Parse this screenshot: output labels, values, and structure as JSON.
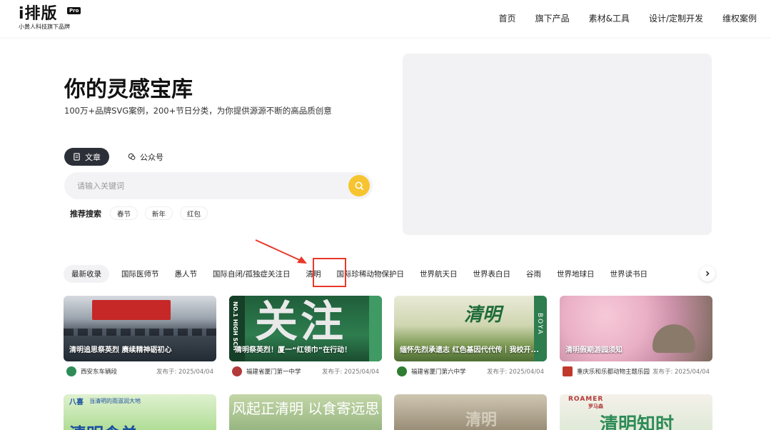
{
  "header": {
    "logo_text": "i排版",
    "logo_badge": "Pro",
    "logo_sub": "小黄人科技旗下品牌",
    "nav": [
      "首页",
      "旗下产品",
      "素材&工具",
      "设计/定制开发",
      "维权案例"
    ]
  },
  "hero": {
    "title": "你的灵感宝库",
    "subtitle": "100万+品牌SVG案例，200+节日分类，为你提供源源不断的高品质创意",
    "tabs": [
      {
        "label": "文章",
        "icon": "document-icon"
      },
      {
        "label": "公众号",
        "icon": "wechat-icon"
      }
    ],
    "search_placeholder": "请输入关键词",
    "hot_label": "推荐搜索",
    "hot_tags": [
      "春节",
      "新年",
      "红包"
    ]
  },
  "categories": [
    "最新收录",
    "国际医师节",
    "愚人节",
    "国际自闭/孤独症关注日",
    "清明",
    "国际珍稀动物保护日",
    "世界航天日",
    "世界表白日",
    "谷雨",
    "世界地球日",
    "世界读书日"
  ],
  "cards": [
    {
      "title": "清明追思祭英烈 赓续精神砺初心",
      "author": "西安东车辆段",
      "date": "发布于: 2025/04/04",
      "avatar_color": "#2e8b57"
    },
    {
      "title": "清明祭英烈！厦一“红领巾”在行动！",
      "author": "福建省厦门第一中学",
      "date": "发布于: 2025/04/04",
      "avatar_color": "#b33a3a"
    },
    {
      "title": "缅怀先烈承遗志 红色基因代代传｜我校开...",
      "author": "福建省厦门第六中学",
      "date": "发布于: 2025/04/04",
      "avatar_color": "#2f7d32"
    },
    {
      "title": "清明假期游园须知",
      "author": "重庆乐和乐都动物主题乐园",
      "date": "发布于: 2025/04/04",
      "avatar_color": "#c0392b"
    }
  ],
  "card_overlays": {
    "card2_big": "关注",
    "card2_side": "NO.1 HIGH SCH",
    "card3_big": "清明",
    "card3_side": "BOYA"
  },
  "row2": {
    "c1_brand": "八喜",
    "c1_tag": "当清明的雨滋润大地",
    "c1_big": "清明食单",
    "c2_big": "风起正清明 以食寄远思",
    "c3_big": "清明",
    "c4_brand": "ROAMER",
    "c4_sub": "罗马森",
    "c4_big": "清明知时"
  }
}
